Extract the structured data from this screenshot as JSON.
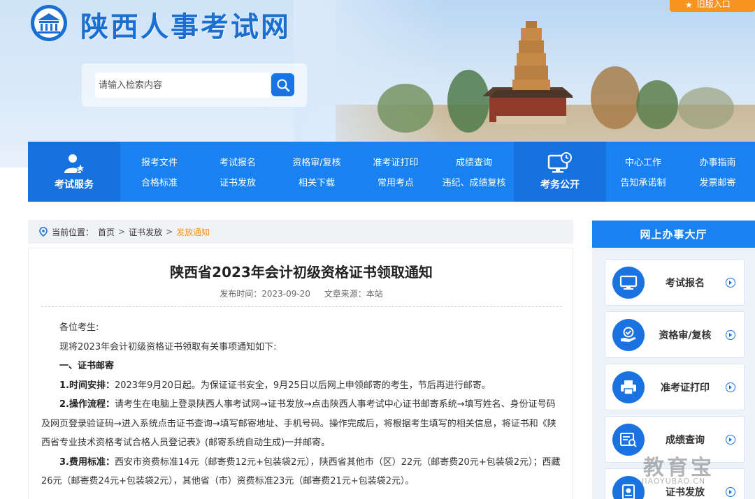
{
  "header": {
    "site_title": "陕西人事考试网",
    "old_version": "旧版入口",
    "search_placeholder": "请输入检索内容"
  },
  "nav": {
    "service_label": "考试服务",
    "public_label": "考务公开",
    "columns": [
      {
        "top": "报考文件",
        "bottom": "合格标准"
      },
      {
        "top": "考试报名",
        "bottom": "证书发放"
      },
      {
        "top": "资格审/复核",
        "bottom": "相关下载"
      },
      {
        "top": "准考证打印",
        "bottom": "常用考点"
      },
      {
        "top": "成绩查询",
        "bottom": "违纪、成绩复核"
      },
      {
        "top": "中心工作",
        "bottom": "告知承诺制"
      },
      {
        "top": "办事指南",
        "bottom": "发票邮寄"
      }
    ]
  },
  "breadcrumb": {
    "prefix": "当前位置：",
    "home": "首页",
    "section": "证书发放",
    "current": "发放通知"
  },
  "article": {
    "title": "陕西省2023年会计初级资格证书领取通知",
    "publish_label": "发布时间：2023-09-20",
    "source_label": "文章来源：本站",
    "greeting": "各位考生:",
    "intro": "现将2023年会计初级资格证书领取有关事项通知如下:",
    "section1": "一、证书邮寄",
    "p1_label": "1.时间安排：",
    "p1_text": "2023年9月20日起。为保证证书安全，9月25日以后网上申领邮寄的考生，节后再进行邮寄。",
    "p2_label": "2.操作流程：",
    "p2_text": "请考生在电脑上登录陕西人事考试网→证书发放→点击陕西人事考试中心证书邮寄系统→填写姓名、身份证号码及网页登录验证码→进入系统点击证书查询→填写邮寄地址、手机号码。操作完成后，将根据考生填写的相关信息，将证书和《陕西省专业技术资格考试合格人员登记表》(邮寄系统自动生成)一并邮寄。",
    "p3_label": "3.费用标准：",
    "p3_text": "西安市资费标准14元（邮寄费12元+包装袋2元），陕西省其他市（区）22元（邮寄费20元+包装袋2元）；西藏26元（邮寄费24元+包装袋2元），其他省（市）资费标准23元（邮寄费21元+包装袋2元）。"
  },
  "sidebar": {
    "title": "网上办事大厅",
    "items": [
      "考试报名",
      "资格审/复核",
      "准考证打印",
      "成绩查询",
      "证书发放"
    ]
  },
  "watermark": {
    "main": "教育宝",
    "sub": "JIAOYUBAO.CN"
  },
  "colors": {
    "primary": "#1a82f0",
    "primary_dark": "#1471dd",
    "accent": "#f7941d"
  }
}
